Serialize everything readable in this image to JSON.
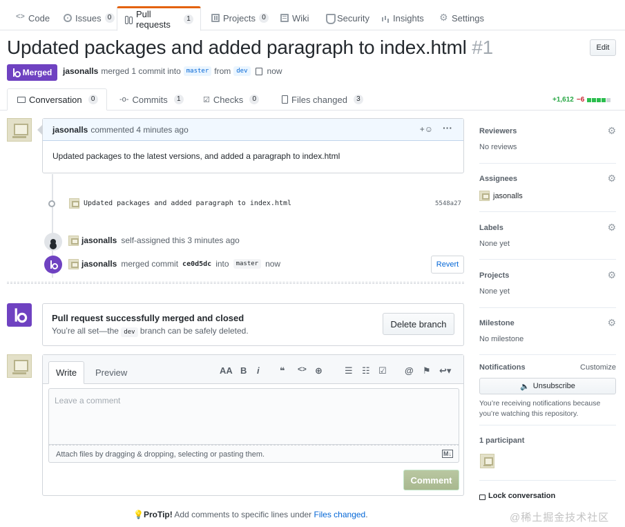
{
  "repo_nav": {
    "tabs": [
      {
        "label": "Code",
        "count": null
      },
      {
        "label": "Issues",
        "count": "0"
      },
      {
        "label": "Pull requests",
        "count": "1"
      },
      {
        "label": "Projects",
        "count": "0"
      },
      {
        "label": "Wiki",
        "count": null
      },
      {
        "label": "Security",
        "count": null
      },
      {
        "label": "Insights",
        "count": null
      },
      {
        "label": "Settings",
        "count": null
      }
    ]
  },
  "pr": {
    "title": "Updated packages and added paragraph to index.html",
    "number": "#1",
    "edit_label": "Edit",
    "state": "Merged",
    "author": "jasonalls",
    "merge_text": "merged 1 commit into",
    "base_branch": "master",
    "from_text": "from",
    "head_branch": "dev",
    "time": "now"
  },
  "pr_tabs": [
    {
      "label": "Conversation",
      "count": "0"
    },
    {
      "label": "Commits",
      "count": "1"
    },
    {
      "label": "Checks",
      "count": "0"
    },
    {
      "label": "Files changed",
      "count": "3"
    }
  ],
  "diffstat": {
    "additions": "+1,612",
    "deletions": "−6"
  },
  "comment": {
    "author": "jasonalls",
    "action": "commented 4 minutes ago",
    "body": "Updated packages to the latest versions, and added a paragraph to index.html",
    "reaction": "+☺",
    "more": "···"
  },
  "timeline": {
    "commit_message": "Updated packages and added paragraph to index.html",
    "commit_sha": "5548a27",
    "assign_user": "jasonalls",
    "assign_text": "self-assigned this 3 minutes ago",
    "merge_user": "jasonalls",
    "merge_text": "merged commit",
    "merge_sha": "ce0d5dc",
    "into_text": "into",
    "merge_branch": "master",
    "merge_time": "now",
    "revert_label": "Revert"
  },
  "merge_status": {
    "title": "Pull request successfully merged and closed",
    "desc_before": "You’re all set—the",
    "branch": "dev",
    "desc_after": "branch can be safely deleted.",
    "delete_label": "Delete branch"
  },
  "new_comment": {
    "write_tab": "Write",
    "preview_tab": "Preview",
    "placeholder": "Leave a comment",
    "attach_text": "Attach files by dragging & dropping, selecting or pasting them.",
    "md_badge": "M↓",
    "submit_label": "Comment",
    "toolbar": [
      "AA",
      "B",
      "i",
      "❝",
      "<>",
      "⊕",
      "☰",
      "☷",
      "☑",
      "@",
      "⚑",
      "↩▾"
    ]
  },
  "protip": {
    "label": "ProTip!",
    "text": "Add comments to specific lines under",
    "link": "Files changed",
    "end": "."
  },
  "sidebar": {
    "reviewers": {
      "heading": "Reviewers",
      "value": "No reviews"
    },
    "assignees": {
      "heading": "Assignees",
      "value": "jasonalls"
    },
    "labels": {
      "heading": "Labels",
      "value": "None yet"
    },
    "projects": {
      "heading": "Projects",
      "value": "None yet"
    },
    "milestone": {
      "heading": "Milestone",
      "value": "No milestone"
    },
    "notifications": {
      "heading": "Notifications",
      "customize": "Customize",
      "button": "Unsubscribe",
      "reason": "You’re receiving notifications because you’re watching this repository."
    },
    "participants": {
      "heading": "1 participant"
    },
    "lock": "Lock conversation"
  },
  "watermark": "@稀土掘金技术社区",
  "colors": {
    "merged": "#6f42c1",
    "link": "#0366d6",
    "add": "#28a745",
    "del": "#cb2431"
  }
}
